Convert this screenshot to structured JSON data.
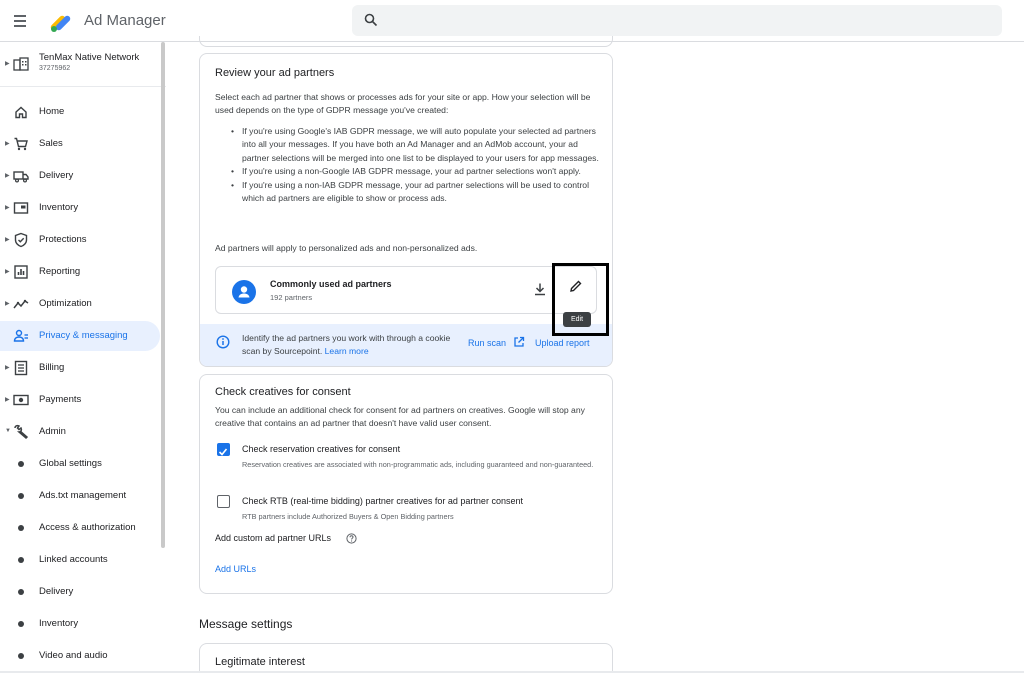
{
  "header": {
    "app_name": "Ad Manager",
    "search_placeholder": ""
  },
  "sidebar": {
    "network_name": "TenMax Native Network",
    "network_id": "37275962",
    "items": [
      {
        "label": "Home"
      },
      {
        "label": "Sales"
      },
      {
        "label": "Delivery"
      },
      {
        "label": "Inventory"
      },
      {
        "label": "Protections"
      },
      {
        "label": "Reporting"
      },
      {
        "label": "Optimization"
      },
      {
        "label": "Privacy & messaging"
      },
      {
        "label": "Billing"
      },
      {
        "label": "Payments"
      },
      {
        "label": "Admin"
      }
    ],
    "admin_subitems": [
      {
        "label": "Global settings"
      },
      {
        "label": "Ads.txt management"
      },
      {
        "label": "Access & authorization"
      },
      {
        "label": "Linked accounts"
      },
      {
        "label": "Delivery"
      },
      {
        "label": "Inventory"
      },
      {
        "label": "Video and audio"
      }
    ]
  },
  "review": {
    "title": "Review your ad partners",
    "intro": "Select each ad partner that shows or processes ads for your site or app. How your selection will be used depends on the type of GDPR message you've created:",
    "bullets": [
      "If you're using Google's IAB GDPR message, we will auto populate your selected ad partners into all your messages. If you have both an Ad Manager and an AdMob account, your ad partner selections will be merged into one list to be displayed to your users for app messages.",
      "If you're using a non-Google IAB GDPR message, your ad partner selections won't apply.",
      "If you're using a non-IAB GDPR message, your ad partner selections will be used to control which ad partners are eligible to show or process ads."
    ],
    "note": "Ad partners will apply to personalized ads and non-personalized ads.",
    "partner_name": "Commonly used ad partners",
    "partner_count": "192 partners",
    "tooltip": "Edit",
    "info_text": "Identify the ad partners you work with through a cookie scan by Sourcepoint.",
    "info_link": "Learn more",
    "run_scan": "Run scan",
    "upload_report": "Upload report"
  },
  "consent": {
    "title": "Check creatives for consent",
    "desc": "You can include an additional check for consent for ad partners on creatives. Google will stop any creative that contains an ad partner that doesn't have valid user consent.",
    "check1_label": "Check reservation creatives for consent",
    "check1_desc": "Reservation creatives are associated with non-programmatic ads, including guaranteed and non-guaranteed.",
    "check1_checked": true,
    "check2_label": "Check RTB (real-time bidding) partner creatives for ad partner consent",
    "check2_desc": "RTB partners include Authorized Buyers & Open Bidding partners",
    "check2_checked": false,
    "custom_urls_label": "Add custom ad partner URLs",
    "add_urls": "Add URLs"
  },
  "message_settings": {
    "title": "Message settings",
    "legit_title": "Legitimate interest"
  },
  "colors": {
    "accent": "#1a73e8",
    "active_bg": "#e8f0fe"
  }
}
